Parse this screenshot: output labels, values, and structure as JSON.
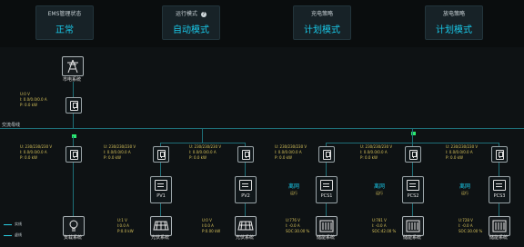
{
  "header": {
    "cards": [
      {
        "title": "EMS管理状态",
        "value": "正常"
      },
      {
        "title": "运行模式",
        "value": "自动模式",
        "help": "?"
      },
      {
        "title": "充电策略",
        "value": "计划模式"
      },
      {
        "title": "放电策略",
        "value": "计划模式"
      }
    ]
  },
  "grid": {
    "label": "市电系统",
    "meter": {
      "u": "U:0 V",
      "i": "I: 0.0/0.0/0.0 A",
      "p": "P: 0.0 kW"
    }
  },
  "bus_label": "交流母线",
  "meters": [
    {
      "u": "U: 230/230/230 V",
      "i": "I: 0.0/0.0/0.0 A",
      "p": "P: 0.0 kW"
    },
    {
      "u": "U: 230/230/230 V",
      "i": "I: 0.0/0.0/0.0 A",
      "p": "P: 0.0 kW"
    },
    {
      "u": "U: 230/230/230 V",
      "i": "I: 0.0/0.0/0.0 A",
      "p": "P: 0.0 kW"
    },
    {
      "u": "U: 230/230/230 V",
      "i": "I: 0.0/0.0/0.0 A",
      "p": "P: 0.0 kW"
    },
    {
      "u": "U: 230/230/230 V",
      "i": "I: 0.0/0.0/0.0 A",
      "p": "P: 0.0 kW"
    },
    {
      "u": "U: 230/230/230 V",
      "i": "I: 0.0/0.0/0.0 A",
      "p": "P: 0.0 kW"
    }
  ],
  "converters": [
    {
      "label": "PV1"
    },
    {
      "label": "PV2"
    },
    {
      "label": "PCS1",
      "mode": "离网",
      "state": "运行"
    },
    {
      "label": "PCS2",
      "mode": "离网",
      "state": "运行"
    },
    {
      "label": "PCS3",
      "mode": "离网",
      "state": "运行"
    }
  ],
  "loads": {
    "label": "负载系统"
  },
  "pv": [
    {
      "label": "光伏系统",
      "u": "U:1 V",
      "i": "I:0.0 A",
      "p": "P:0.0 kW"
    },
    {
      "label": "光伏系统",
      "u": "U:0 V",
      "i": "I:0.0 A",
      "p": "P:0.00 kW"
    }
  ],
  "storage": [
    {
      "label": "储能系统",
      "u": "U:776 V",
      "i": "I: -0.0 A",
      "soc": "SOC:30.00 %"
    },
    {
      "label": "储能系统",
      "u": "U:781 V",
      "i": "I: -0.0 A",
      "soc": "SOC:42.00 %"
    },
    {
      "label": "储能系统",
      "u": "U:728 V",
      "i": "I: -0.0 A",
      "soc": "SOC:30.00 %"
    }
  ],
  "legend": [
    {
      "label": "实线",
      "color": "#2ad0e4"
    },
    {
      "label": "虚线",
      "color": "#2ad0e4"
    }
  ]
}
